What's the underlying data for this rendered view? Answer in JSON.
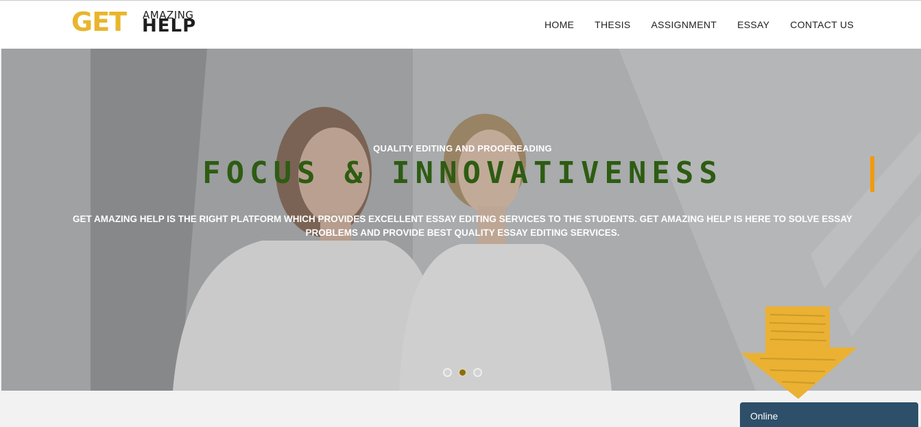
{
  "logo": {
    "get": "GET",
    "amazing": "AMAZING",
    "help": "HELP",
    "colors": {
      "get": "#e9b52c",
      "help": "#1e1e1e"
    }
  },
  "nav": {
    "items": [
      "HOME",
      "THESIS",
      "ASSIGNMENT",
      "ESSAY",
      "CONTACT US"
    ]
  },
  "hero": {
    "kicker": "QUALITY EDITING AND PROOFREADING",
    "headline": "FOCUS & INNOVATIVENESS",
    "description": "GET AMAZING HELP IS THE RIGHT PLATFORM WHICH PROVIDES EXCELLENT ESSAY EDITING SERVICES TO THE STUDENTS. GET AMAZING HELP IS HERE TO SOLVE ESSAY PROBLEMS AND PROVIDE BEST QUALITY ESSAY EDITING SERVICES.",
    "slides_total": 3,
    "active_slide": 2,
    "colors": {
      "headline": "#2d5c12",
      "cursor": "#f29a0e"
    }
  },
  "decorations": {
    "arrow_icon": "hand-drawn-down-arrow-icon",
    "arrow_color": "#eab133"
  },
  "chat": {
    "status": "Online",
    "color": "#2d4f69"
  }
}
